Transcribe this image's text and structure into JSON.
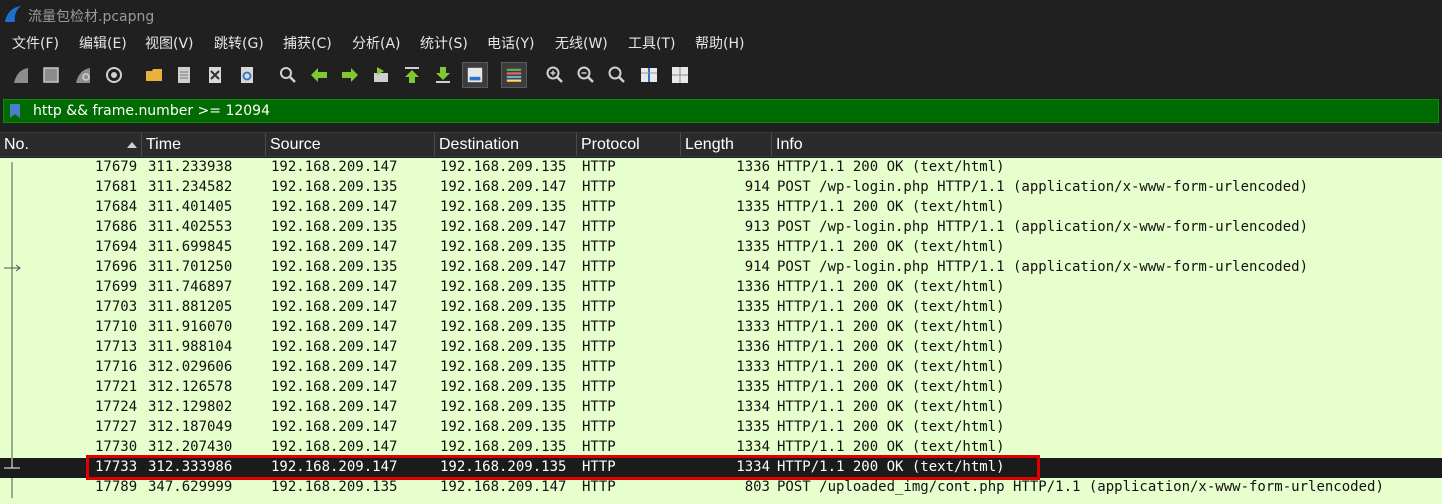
{
  "window": {
    "title": "流量包检材.pcapng",
    "icon": "wireshark-fin-icon"
  },
  "menu": [
    {
      "label": "文件(F)"
    },
    {
      "label": "编辑(E)"
    },
    {
      "label": "视图(V)"
    },
    {
      "label": "跳转(G)"
    },
    {
      "label": "捕获(C)"
    },
    {
      "label": "分析(A)"
    },
    {
      "label": "统计(S)"
    },
    {
      "label": "电话(Y)"
    },
    {
      "label": "无线(W)"
    },
    {
      "label": "工具(T)"
    },
    {
      "label": "帮助(H)"
    }
  ],
  "toolbar": {
    "icons": [
      "start-capture-icon",
      "stop-capture-icon",
      "restart-capture-icon",
      "capture-options-icon",
      "open-file-icon",
      "save-file-icon",
      "close-file-icon",
      "reload-file-icon",
      "find-packet-icon",
      "go-back-icon",
      "go-forward-icon",
      "go-to-packet-icon",
      "go-first-icon",
      "go-last-icon",
      "auto-scroll-icon",
      "colorize-icon",
      "zoom-in-icon",
      "zoom-out-icon",
      "normal-size-icon",
      "resize-columns-icon",
      "layout-icon"
    ]
  },
  "filter": {
    "value": "http && frame.number >= 12094",
    "icon": "bookmark-icon"
  },
  "columns": [
    "No.",
    "Time",
    "Source",
    "Destination",
    "Protocol",
    "Length",
    "Info"
  ],
  "sort": {
    "column": "No.",
    "direction": "ascending"
  },
  "rows": [
    {
      "no": "17679",
      "time": "311.233938",
      "src": "192.168.209.147",
      "dst": "192.168.209.135",
      "proto": "HTTP",
      "len": "1336",
      "info": "HTTP/1.1 200 OK  (text/html)"
    },
    {
      "no": "17681",
      "time": "311.234582",
      "src": "192.168.209.135",
      "dst": "192.168.209.147",
      "proto": "HTTP",
      "len": "914",
      "info": "POST /wp-login.php HTTP/1.1  (application/x-www-form-urlencoded)"
    },
    {
      "no": "17684",
      "time": "311.401405",
      "src": "192.168.209.147",
      "dst": "192.168.209.135",
      "proto": "HTTP",
      "len": "1335",
      "info": "HTTP/1.1 200 OK  (text/html)"
    },
    {
      "no": "17686",
      "time": "311.402553",
      "src": "192.168.209.135",
      "dst": "192.168.209.147",
      "proto": "HTTP",
      "len": "913",
      "info": "POST /wp-login.php HTTP/1.1  (application/x-www-form-urlencoded)"
    },
    {
      "no": "17694",
      "time": "311.699845",
      "src": "192.168.209.147",
      "dst": "192.168.209.135",
      "proto": "HTTP",
      "len": "1335",
      "info": "HTTP/1.1 200 OK  (text/html)"
    },
    {
      "no": "17696",
      "time": "311.701250",
      "src": "192.168.209.135",
      "dst": "192.168.209.147",
      "proto": "HTTP",
      "len": "914",
      "info": "POST /wp-login.php HTTP/1.1  (application/x-www-form-urlencoded)"
    },
    {
      "no": "17699",
      "time": "311.746897",
      "src": "192.168.209.147",
      "dst": "192.168.209.135",
      "proto": "HTTP",
      "len": "1336",
      "info": "HTTP/1.1 200 OK  (text/html)"
    },
    {
      "no": "17703",
      "time": "311.881205",
      "src": "192.168.209.147",
      "dst": "192.168.209.135",
      "proto": "HTTP",
      "len": "1335",
      "info": "HTTP/1.1 200 OK  (text/html)"
    },
    {
      "no": "17710",
      "time": "311.916070",
      "src": "192.168.209.147",
      "dst": "192.168.209.135",
      "proto": "HTTP",
      "len": "1333",
      "info": "HTTP/1.1 200 OK  (text/html)"
    },
    {
      "no": "17713",
      "time": "311.988104",
      "src": "192.168.209.147",
      "dst": "192.168.209.135",
      "proto": "HTTP",
      "len": "1336",
      "info": "HTTP/1.1 200 OK  (text/html)"
    },
    {
      "no": "17716",
      "time": "312.029606",
      "src": "192.168.209.147",
      "dst": "192.168.209.135",
      "proto": "HTTP",
      "len": "1333",
      "info": "HTTP/1.1 200 OK  (text/html)"
    },
    {
      "no": "17721",
      "time": "312.126578",
      "src": "192.168.209.147",
      "dst": "192.168.209.135",
      "proto": "HTTP",
      "len": "1335",
      "info": "HTTP/1.1 200 OK  (text/html)"
    },
    {
      "no": "17724",
      "time": "312.129802",
      "src": "192.168.209.147",
      "dst": "192.168.209.135",
      "proto": "HTTP",
      "len": "1334",
      "info": "HTTP/1.1 200 OK  (text/html)"
    },
    {
      "no": "17727",
      "time": "312.187049",
      "src": "192.168.209.147",
      "dst": "192.168.209.135",
      "proto": "HTTP",
      "len": "1335",
      "info": "HTTP/1.1 200 OK  (text/html)"
    },
    {
      "no": "17730",
      "time": "312.207430",
      "src": "192.168.209.147",
      "dst": "192.168.209.135",
      "proto": "HTTP",
      "len": "1334",
      "info": "HTTP/1.1 200 OK  (text/html)"
    },
    {
      "no": "17733",
      "time": "312.333986",
      "src": "192.168.209.147",
      "dst": "192.168.209.135",
      "proto": "HTTP",
      "len": "1334",
      "info": "HTTP/1.1 200 OK  (text/html)",
      "selected": true
    },
    {
      "no": "17789",
      "time": "347.629999",
      "src": "192.168.209.135",
      "dst": "192.168.209.147",
      "proto": "HTTP",
      "len": "803",
      "info": "POST /uploaded_img/cont.php HTTP/1.1  (application/x-www-form-urlencoded)"
    }
  ],
  "colors": {
    "row_bg": "#e6ffcc",
    "selected_bg": "#1b1b1b",
    "filter_bg": "#006b00",
    "highlight_border": "#e00000"
  }
}
